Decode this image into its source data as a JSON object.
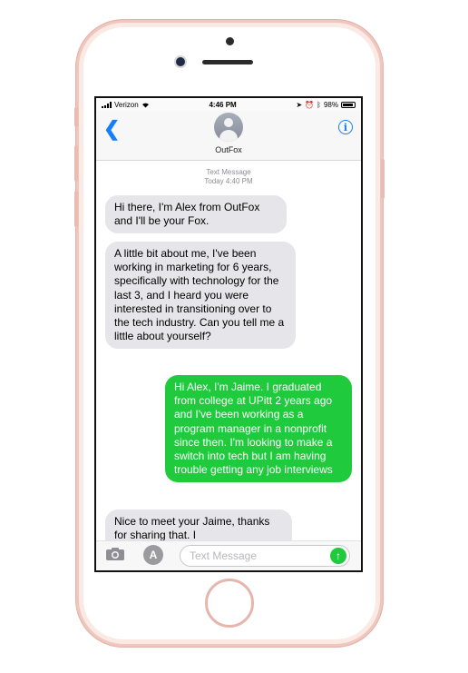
{
  "status_bar": {
    "carrier": "Verizon",
    "time": "4:46 PM",
    "battery": "98%"
  },
  "conversation": {
    "contact_name": "OutFox",
    "meta_type": "Text Message",
    "meta_time": "Today 4:40 PM",
    "messages": [
      {
        "direction": "received",
        "text": "Hi there, I'm Alex from OutFox and I'll be your Fox."
      },
      {
        "direction": "received",
        "text": "A little bit about me, I've been working in marketing for 6 years, specifically with technology for the last 3, and I heard you were interested in transitioning over to the tech industry. Can you tell me a little about yourself?"
      },
      {
        "direction": "sent",
        "text": "Hi Alex, I'm Jaime. I graduated from college at UPitt 2 years ago and I've been working as a program manager in a nonprofit since then. I'm looking to make a switch into tech but I am having trouble getting any job interviews"
      },
      {
        "direction": "received",
        "text": "Nice to meet your Jaime, thanks for sharing that. I"
      }
    ]
  },
  "composer": {
    "placeholder": "Text Message",
    "value": ""
  },
  "colors": {
    "accent_blue": "#157efb",
    "sent_bubble": "#1fca3c",
    "received_bubble": "#e5e5ea",
    "phone_frame": "#efc7bf"
  },
  "icons": {
    "back": "chevron-left-icon",
    "info": "info-icon",
    "camera": "camera-icon",
    "apps": "app-store-icon",
    "send": "send-arrow-icon"
  }
}
